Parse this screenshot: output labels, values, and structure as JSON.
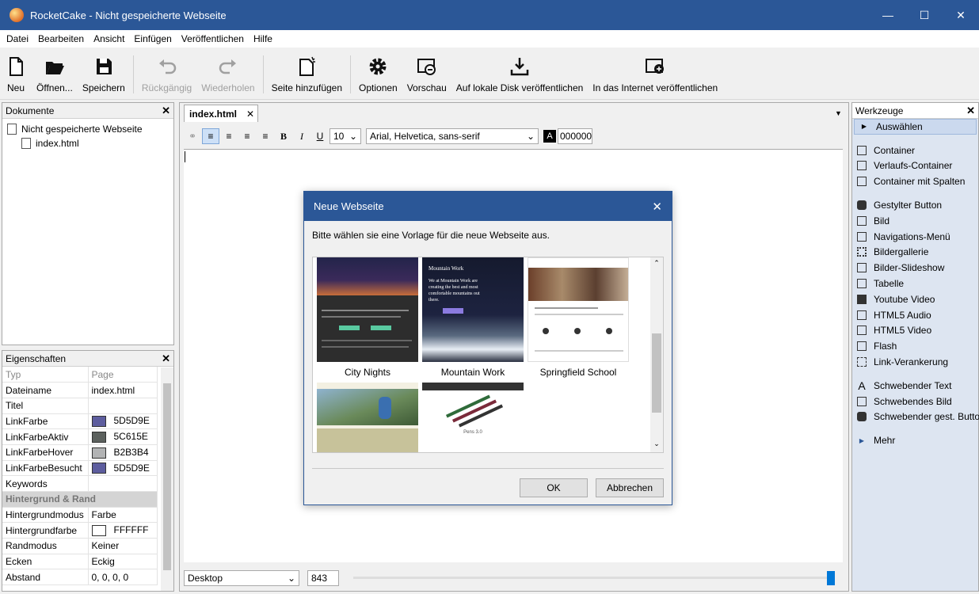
{
  "window": {
    "title": "RocketCake - Nicht gespeicherte Webseite"
  },
  "menu": [
    "Datei",
    "Bearbeiten",
    "Ansicht",
    "Einfügen",
    "Veröffentlichen",
    "Hilfe"
  ],
  "toolbar": {
    "neu": "Neu",
    "oeffnen": "Öffnen...",
    "speichern": "Speichern",
    "rueck": "Rückgängig",
    "wieder": "Wiederholen",
    "seite": "Seite hinzufügen",
    "optionen": "Optionen",
    "vorschau": "Vorschau",
    "lokal": "Auf lokale Disk veröffentlichen",
    "internet": "In das Internet veröffentlichen"
  },
  "dokumente": {
    "title": "Dokumente",
    "root": "Nicht gespeicherte Webseite",
    "child": "index.html"
  },
  "eigenschaften": {
    "title": "Eigenschaften",
    "header": [
      "Typ",
      "Page"
    ],
    "rows": [
      {
        "k": "Dateiname",
        "v": "index.html"
      },
      {
        "k": "Titel",
        "v": ""
      },
      {
        "k": "LinkFarbe",
        "v": "5D5D9E",
        "c": "#5D5D9E"
      },
      {
        "k": "LinkFarbeAktiv",
        "v": "5C615E",
        "c": "#5C615E"
      },
      {
        "k": "LinkFarbeHover",
        "v": "B2B3B4",
        "c": "#B2B3B4"
      },
      {
        "k": "LinkFarbeBesucht",
        "v": "5D5D9E",
        "c": "#5D5D9E"
      },
      {
        "k": "Keywords",
        "v": ""
      }
    ],
    "group": "Hintergrund & Rand",
    "rows2": [
      {
        "k": "Hintergrundmodus",
        "v": "Farbe"
      },
      {
        "k": "Hintergrundfarbe",
        "v": "FFFFFF",
        "c": "#FFFFFF"
      },
      {
        "k": "Randmodus",
        "v": "Keiner"
      },
      {
        "k": "Ecken",
        "v": "Eckig"
      },
      {
        "k": "Abstand",
        "v": "0, 0, 0, 0"
      }
    ]
  },
  "editor": {
    "tab": "index.html",
    "fontsize": "10",
    "font": "Arial, Helvetica, sans-serif",
    "color": "000000",
    "view": "Desktop",
    "width": "843"
  },
  "dialog": {
    "title": "Neue Webseite",
    "message": "Bitte wählen sie eine Vorlage für die neue Webseite aus.",
    "templates": [
      "City Nights",
      "Mountain Work",
      "Springfield School"
    ],
    "ok": "OK",
    "cancel": "Abbrechen",
    "thumb_text": {
      "mw_head": "Mountain Work",
      "mw_body": "We at Mountain Work are creating the best and most comfortable mountains out there.",
      "pens": "Pens 3.0"
    }
  },
  "werkzeuge": {
    "title": "Werkzeuge",
    "groups": [
      [
        "Auswählen"
      ],
      [
        "Container",
        "Verlaufs-Container",
        "Container mit Spalten"
      ],
      [
        "Gestylter Button",
        "Bild",
        "Navigations-Menü",
        "Bildergallerie",
        "Bilder-Slideshow",
        "Tabelle",
        "Youtube Video",
        "HTML5 Audio",
        "HTML5 Video",
        "Flash",
        "Link-Verankerung"
      ],
      [
        "Schwebender Text",
        "Schwebendes Bild",
        "Schwebender gest. Button"
      ],
      [
        "Mehr"
      ]
    ]
  }
}
